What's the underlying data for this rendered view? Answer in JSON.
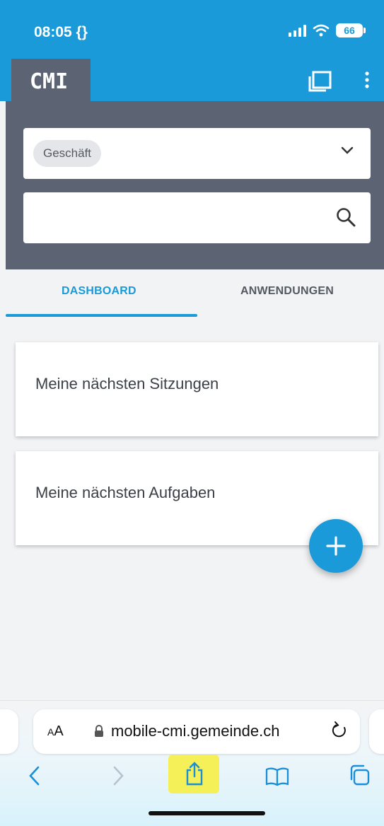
{
  "status_bar": {
    "time": "08:05 {}",
    "battery": "66"
  },
  "app": {
    "logo": "CMI"
  },
  "filter": {
    "chip_label": "Geschäft"
  },
  "search": {
    "placeholder": ""
  },
  "tabs": [
    {
      "label": "DASHBOARD",
      "active": true
    },
    {
      "label": "ANWENDUNGEN",
      "active": false
    }
  ],
  "cards": [
    {
      "title": "Meine nächsten Sitzungen"
    },
    {
      "title": "Meine nächsten Aufgaben"
    }
  ],
  "browser": {
    "text_size_label_small": "A",
    "text_size_label_large": "A",
    "url": "mobile-cmi.gemeinde.ch"
  },
  "colors": {
    "accent": "#1a9ad8",
    "header_gray": "#5c6474",
    "background": "#f2f3f5"
  }
}
